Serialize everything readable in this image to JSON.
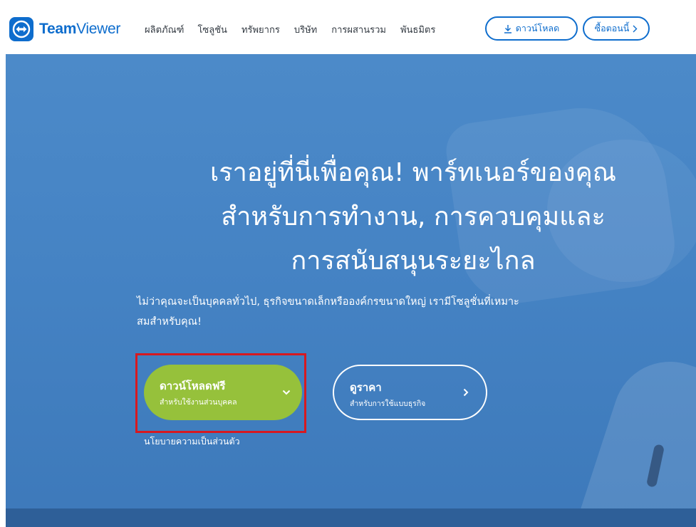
{
  "header": {
    "logo": {
      "brand_bold": "Team",
      "brand_regular": "Viewer"
    },
    "nav": [
      {
        "label": "ผลิตภัณฑ์"
      },
      {
        "label": "โซลูชัน"
      },
      {
        "label": "ทรัพยากร"
      },
      {
        "label": "บริษัท"
      },
      {
        "label": "การผสานรวม"
      },
      {
        "label": "พันธมิตร"
      }
    ],
    "download_label": "ดาวน์โหลด",
    "buy_label": "ซื้อตอนนี้"
  },
  "hero": {
    "title_lines": [
      "เราอยู่ที่นี่เพื่อคุณ! พาร์ทเนอร์ของคุณ",
      "สำหรับการทำงาน, การควบคุมและ",
      "การสนับสนุนระยะไกล"
    ],
    "subtitle_lines": [
      "ไม่ว่าคุณจะเป็นบุคคลทั่วไป, ธุรกิจขนาดเล็กหรือองค์กรขนาดใหญ่ เรามีโซลูชั่นที่เหมาะ",
      "สมสำหรับคุณ!"
    ],
    "free_button": {
      "title": "ดาวน์โหลดฟรี",
      "subtitle": "สำหรับใช้งานส่วนบุคคล"
    },
    "price_button": {
      "title": "ดูราคา",
      "subtitle": "สำหรับการใช้แบบธุรกิจ"
    },
    "privacy_link": "นโยบายความเป็นส่วนตัว"
  },
  "colors": {
    "brand_blue": "#0e6dcd",
    "hero_blue": "#4583c4",
    "cta_green": "#96c13b",
    "highlight_red": "#d71920"
  }
}
